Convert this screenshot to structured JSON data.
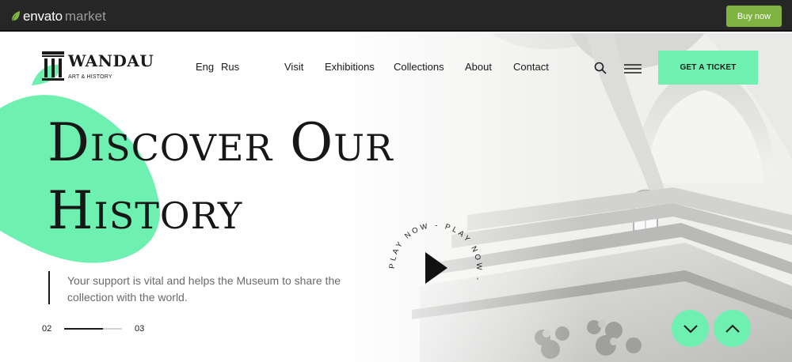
{
  "topbar": {
    "brand": "envato",
    "brand_suffix": "market",
    "buy_label": "Buy now",
    "accent": "#7fb241"
  },
  "header": {
    "logo_title": "WANDAU",
    "logo_subtitle": "ART & HISTORY",
    "languages": [
      "Eng",
      "Rus"
    ],
    "nav": [
      "Visit",
      "Exhibitions",
      "Collections",
      "About",
      "Contact"
    ],
    "ticket_label": "GET A TICKET",
    "accent": "#6ef0b0",
    "icons": [
      "search-icon",
      "hamburger-menu-icon"
    ]
  },
  "hero": {
    "headline_line1": "Discover Our",
    "headline_line2": "History",
    "support": "Your support is vital and helps the Museum to share the collection with the world.",
    "slide_current": "02",
    "slide_total": "03",
    "slide_progress": 0.67,
    "play_label": "PLAY NOW - PLAY NOW -",
    "nav_icons": [
      "chevron-down-icon",
      "chevron-up-icon"
    ]
  }
}
